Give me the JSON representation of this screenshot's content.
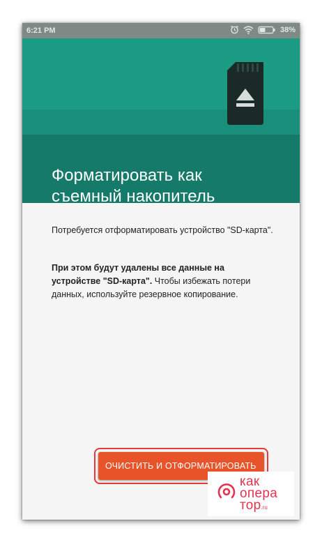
{
  "status_bar": {
    "time": "6:21 PM",
    "battery_percent": "38%",
    "icons": [
      "alarm-icon",
      "wifi-icon",
      "battery-icon"
    ]
  },
  "header": {
    "title_line1": "Форматировать как",
    "title_line2": "съемный накопитель",
    "icon": "sd-card-eject-icon",
    "colors": {
      "top": "#1c9b84",
      "bottom": "#157a69"
    }
  },
  "content": {
    "paragraph1": "Потребуется отформатировать устройство \"SD-карта\".",
    "paragraph2_bold": "При этом будут удалены все данные на устройстве \"SD-карта\".",
    "paragraph2_rest": " Чтобы избежать потери данных, используйте резервное копирование."
  },
  "actions": {
    "format_button_label": "ОЧИСТИТЬ И ОТФОРМАТИРОВАТЬ",
    "button_color": "#e8532a",
    "highlight_color": "#e53935"
  },
  "watermark": {
    "line1": "как",
    "line2": "опера",
    "line3": "тор",
    "suffix": ".ru",
    "color": "#e5334f"
  }
}
